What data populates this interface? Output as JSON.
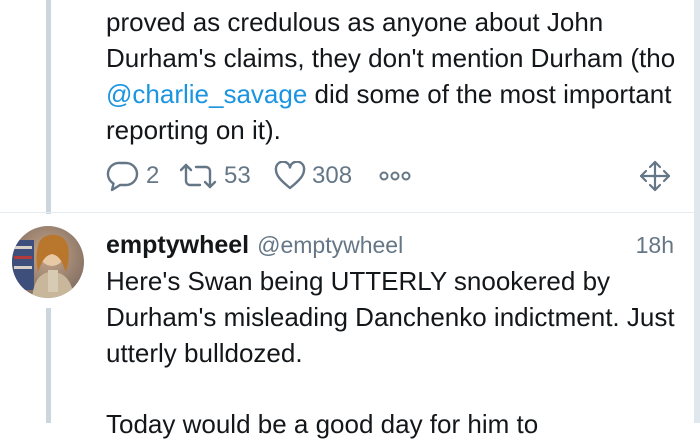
{
  "tweet1": {
    "text_before": "proved as credulous as anyone about John Durham's claims, they don't mention Durham (tho ",
    "mention": "@charlie_savage",
    "text_after": " did some of the most important reporting on it).",
    "reply_count": "2",
    "retweet_count": "53",
    "like_count": "308"
  },
  "tweet2": {
    "display_name": "emptywheel",
    "handle": "@emptywheel",
    "timestamp": "18h",
    "text": "Here's Swan being UTTERLY snookered by Durham's misleading Danchenko indictment. Just utterly bulldozed.",
    "text_cutoff": "Today would be a good day for him to"
  },
  "icons": {
    "reply": "reply-icon",
    "retweet": "retweet-icon",
    "like": "heart-icon",
    "more": "more-icon",
    "move": "move-icon"
  },
  "colors": {
    "text": "#14171a",
    "secondary": "#657786",
    "link": "#1b95e0",
    "thread_line": "#ccd6dd"
  }
}
